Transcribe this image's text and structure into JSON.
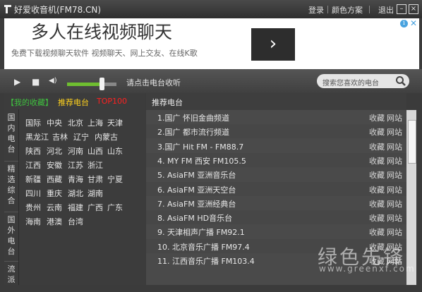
{
  "title_bar": {
    "app_title": "好爱收音机(FM78.CN)",
    "login": "登录",
    "color_scheme": "颜色方案",
    "exit": "退出",
    "minimize": "–",
    "close": "×"
  },
  "ad": {
    "headline": "多人在线视频聊天",
    "subline": "免费下载视频聊天软件  视频聊天、网上交友、在线K歌",
    "arrow": "›",
    "info": "i",
    "close": "✕"
  },
  "player": {
    "play": "▶",
    "stop": "■",
    "volume_icon": "◀)",
    "volume_level": 0.72,
    "hint": "请点击电台收听",
    "search_placeholder": "搜索您喜欢的电台"
  },
  "left_tabs": {
    "my_favorites": "【我的收藏】",
    "recommended": "推荐电台",
    "top100": "TOP100"
  },
  "side_tabs": [
    "国内电台",
    "精选综合",
    "国外电台",
    "流派"
  ],
  "regions": [
    [
      "国际",
      "中央",
      "北京",
      "上海",
      "天津"
    ],
    [
      "黑龙江",
      "吉林",
      "辽宁",
      "内蒙古"
    ],
    [
      "陕西",
      "河北",
      "河南",
      "山西",
      "山东"
    ],
    [
      "江西",
      "安徽",
      "江苏",
      "浙江"
    ],
    [
      "新疆",
      "西藏",
      "青海",
      "甘肃",
      "宁夏"
    ],
    [
      "四川",
      "重庆",
      "湖北",
      "湖南"
    ],
    [
      "贵州",
      "云南",
      "福建",
      "广西",
      "广东"
    ],
    [
      "海南",
      "港澳",
      "台湾"
    ]
  ],
  "stations_header": "推荐电台",
  "stations": [
    "1.国广 怀旧金曲频道",
    "2.国广 都市流行频道",
    "3.国广 Hit FM - FM88.7",
    "4. MY FM 西安 FM105.5",
    "5. AsiaFM 亚洲音乐台",
    "6. AsiaFM 亚洲天空台",
    "7. AsiaFM 亚洲经典台",
    "8. AsiaFM HD音乐台",
    "9. 天津相声广播 FM92.1",
    "10. 北京音乐广播 FM97.4",
    "11. 江西音乐广播 FM103.4"
  ],
  "row_actions": {
    "favorite": "收藏",
    "site": "网站"
  },
  "watermark": {
    "main": "绿色先锋",
    "sub": "www.greenxf.com"
  },
  "colors": {
    "favorites_tab": "#3fc03f",
    "recommended_tab": "#ffd21e",
    "top100_tab": "#ff2020",
    "volume_fill": "#6fbe30"
  }
}
